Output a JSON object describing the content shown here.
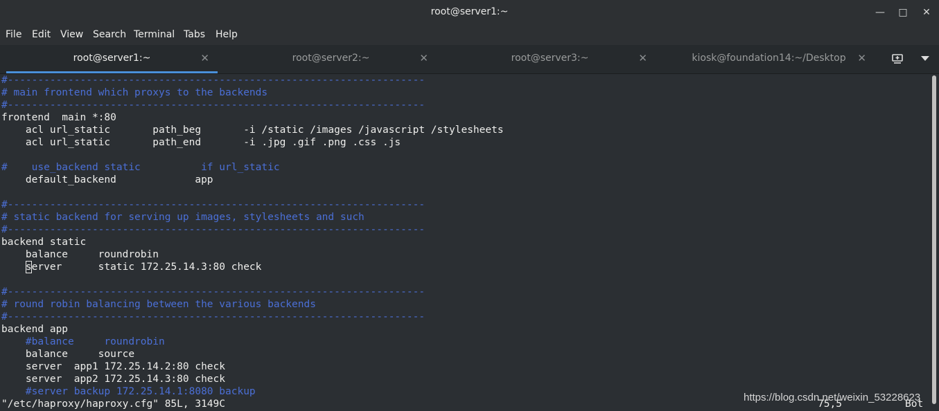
{
  "window": {
    "title": "root@server1:~"
  },
  "menubar": {
    "items": [
      "File",
      "Edit",
      "View",
      "Search",
      "Terminal",
      "Tabs",
      "Help"
    ]
  },
  "tabs": [
    {
      "label": "root@server1:~",
      "active": true
    },
    {
      "label": "root@server2:~",
      "active": false
    },
    {
      "label": "root@server3:~",
      "active": false
    },
    {
      "label": "kiosk@foundation14:~/Desktop",
      "active": false
    }
  ],
  "terminal": {
    "lines": [
      {
        "text": "#---------------------------------------------------------------------",
        "type": "comment"
      },
      {
        "text": "# main frontend which proxys to the backends",
        "type": "comment"
      },
      {
        "text": "#---------------------------------------------------------------------",
        "type": "comment"
      },
      {
        "text": "frontend  main *:80",
        "type": "normal"
      },
      {
        "text": "    acl url_static       path_beg       -i /static /images /javascript /stylesheets",
        "type": "normal"
      },
      {
        "text": "    acl url_static       path_end       -i .jpg .gif .png .css .js",
        "type": "normal"
      },
      {
        "text": "",
        "type": "normal"
      },
      {
        "text": "#    use_backend static          if url_static",
        "type": "comment"
      },
      {
        "text": "    default_backend             app",
        "type": "normal"
      },
      {
        "text": "",
        "type": "normal"
      },
      {
        "text": "#---------------------------------------------------------------------",
        "type": "comment"
      },
      {
        "text": "# static backend for serving up images, stylesheets and such",
        "type": "comment"
      },
      {
        "text": "#---------------------------------------------------------------------",
        "type": "comment"
      },
      {
        "text": "backend static",
        "type": "normal"
      },
      {
        "text": "    balance     roundrobin",
        "type": "normal"
      },
      {
        "text": "    server      static 172.25.14.3:80 check",
        "type": "normal",
        "cursor_col": 4
      },
      {
        "text": "",
        "type": "normal"
      },
      {
        "text": "#---------------------------------------------------------------------",
        "type": "comment"
      },
      {
        "text": "# round robin balancing between the various backends",
        "type": "comment"
      },
      {
        "text": "#---------------------------------------------------------------------",
        "type": "comment"
      },
      {
        "text": "backend app",
        "type": "normal"
      },
      {
        "text": "    #balance     roundrobin",
        "type": "comment"
      },
      {
        "text": "    balance     source",
        "type": "normal"
      },
      {
        "text": "    server  app1 172.25.14.2:80 check",
        "type": "normal"
      },
      {
        "text": "    server  app2 172.25.14.3:80 check",
        "type": "normal"
      },
      {
        "text": "    #server backup 172.25.14.1:8080 backup",
        "type": "comment"
      }
    ],
    "status_left": "\"/etc/haproxy/haproxy.cfg\" 85L, 3149C",
    "status_pos": "75,5",
    "status_scroll": "Bot"
  },
  "watermark": "https://blog.csdn.net/weixin_53228623"
}
